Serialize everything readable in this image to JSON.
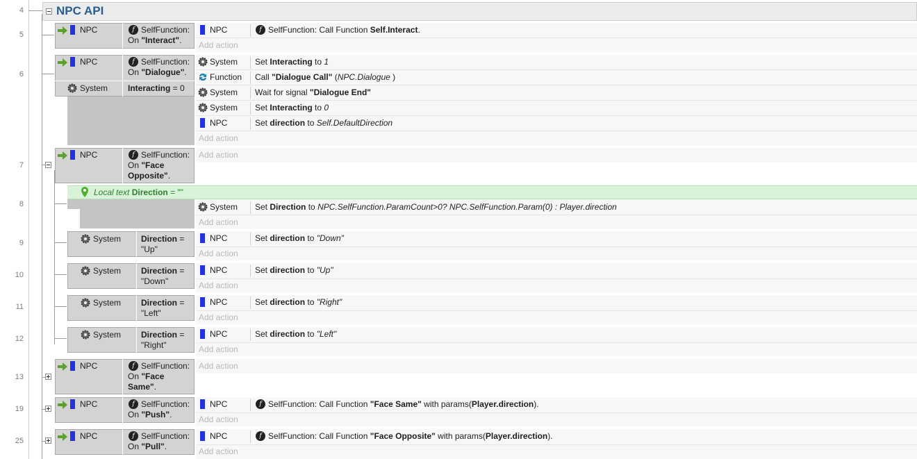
{
  "group": {
    "title": "NPC API",
    "line": "4"
  },
  "add_action": "Add action",
  "line_numbers": [
    "5",
    "6",
    "7",
    "8",
    "9",
    "10",
    "11",
    "12",
    "13",
    "19",
    "25"
  ],
  "colors": {
    "title": "#2a5d8f",
    "object_icon": "#2233dd",
    "arrow": "#5aa02c",
    "localvar_bg": "#d9f3d9"
  },
  "ev5": {
    "obj": "NPC",
    "cond1": "SelfFunction:",
    "cond2a": "On ",
    "cond2b": "\"Interact\"",
    "cond2c": ".",
    "act_obj": "NPC",
    "act_a": "SelfFunction: Call Function ",
    "act_b": "Self.Interact",
    "act_c": "."
  },
  "ev6": {
    "obj": "NPC",
    "cond1": "SelfFunction:",
    "cond2a": "On ",
    "cond2b": "\"Dialogue\"",
    "cond2c": ".",
    "sys": "System",
    "sysc_a": "Interacting",
    "sysc_b": " = 0",
    "acts": [
      {
        "obj": "System",
        "a": "Set ",
        "b": "Interacting",
        "c": " to ",
        "d": "1"
      },
      {
        "obj": "Function",
        "a": "Call ",
        "b": "\"Dialogue Call\"",
        "c": " (",
        "d": "NPC.Dialogue",
        "e": " )"
      },
      {
        "obj": "System",
        "a": "Wait for signal ",
        "b": "\"Dialogue End\""
      },
      {
        "obj": "System",
        "a": "Set ",
        "b": "Interacting",
        "c": " to ",
        "d": "0"
      },
      {
        "obj": "NPC",
        "a": "Set ",
        "b": "direction",
        "c": " to ",
        "d": "Self.DefaultDirection"
      }
    ]
  },
  "ev7": {
    "obj": "NPC",
    "cond1": "SelfFunction:",
    "cond2a": "On ",
    "cond2b": "\"Face",
    "cond3": "Opposite\"",
    "cond3c": "."
  },
  "localvar": {
    "label": "Local text",
    "name": "Direction",
    "eq": " = ",
    "value": "\"\""
  },
  "ev8": {
    "act_obj": "System",
    "a": "Set ",
    "b": "Direction",
    "c": " to ",
    "d": "NPC.SelfFunction.ParamCount>0? NPC.SelfFunction.Param(0) : Player.direction"
  },
  "subs": [
    {
      "sys": "System",
      "c1": "Direction",
      "c1b": " =",
      "c2": "\"Up\"",
      "act_obj": "NPC",
      "a": "Set ",
      "b": "direction",
      "c": " to ",
      "d": "\"Down\""
    },
    {
      "sys": "System",
      "c1": "Direction",
      "c1b": " =",
      "c2": "\"Down\"",
      "act_obj": "NPC",
      "a": "Set ",
      "b": "direction",
      "c": " to ",
      "d": "\"Up\""
    },
    {
      "sys": "System",
      "c1": "Direction",
      "c1b": " =",
      "c2": "\"Left\"",
      "act_obj": "NPC",
      "a": "Set ",
      "b": "direction",
      "c": " to ",
      "d": "\"Right\""
    },
    {
      "sys": "System",
      "c1": "Direction",
      "c1b": " =",
      "c2": "\"Right\"",
      "act_obj": "NPC",
      "a": "Set ",
      "b": "direction",
      "c": " to ",
      "d": "\"Left\""
    }
  ],
  "ev13": {
    "obj": "NPC",
    "cond1": "SelfFunction:",
    "cond2a": "On ",
    "cond2b": "\"Face",
    "cond3": "Same\"",
    "cond3c": "."
  },
  "ev19": {
    "obj": "NPC",
    "cond1": "SelfFunction:",
    "cond2a": "On ",
    "cond2b": "\"Push\"",
    "cond2c": ".",
    "act_obj": "NPC",
    "a": "SelfFunction: Call Function ",
    "b": "\"Face Same\"",
    "c": " with params(",
    "d": "Player.direction",
    "e": ")."
  },
  "ev25": {
    "obj": "NPC",
    "cond1": "SelfFunction:",
    "cond2a": "On ",
    "cond2b": "\"Pull\"",
    "cond2c": ".",
    "act_obj": "NPC",
    "a": "SelfFunction: Call Function ",
    "b": "\"Face Opposite\"",
    "c": " with params(",
    "d": "Player.direction",
    "e": ")."
  }
}
